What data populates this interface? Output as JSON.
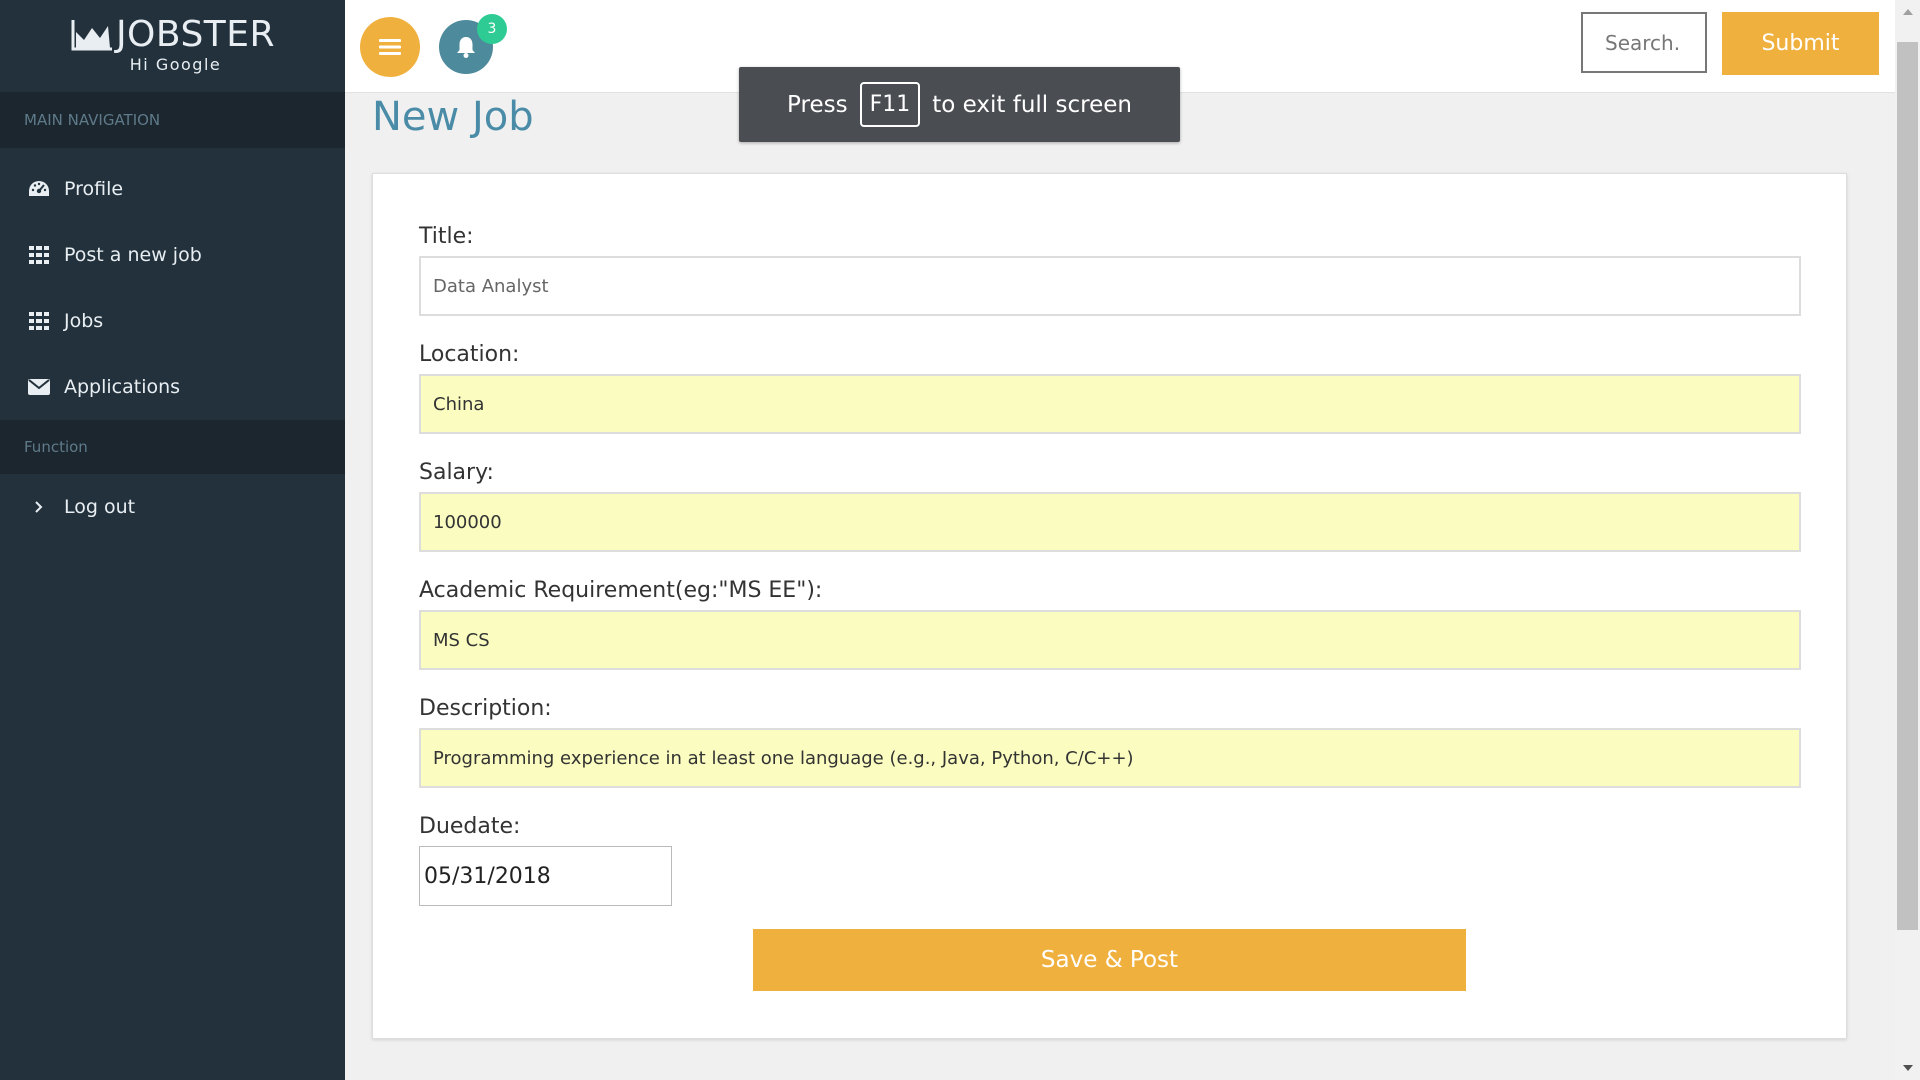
{
  "sidebar": {
    "brand_name": "JOBSTER",
    "greeting": "Hi Google",
    "nav_header": "MAIN NAVIGATION",
    "items": [
      {
        "label": "Profile",
        "icon": "dashboard-icon"
      },
      {
        "label": "Post a new job",
        "icon": "grid-icon"
      },
      {
        "label": "Jobs",
        "icon": "grid-icon"
      },
      {
        "label": "Applications",
        "icon": "envelope-icon"
      }
    ],
    "function_header": "Function",
    "logout_label": "Log out"
  },
  "topbar": {
    "notification_count": "3",
    "search_placeholder": "Search.",
    "submit_label": "Submit"
  },
  "fullscreen_toast": {
    "press": "Press",
    "key": "F11",
    "rest": "to exit full screen"
  },
  "page": {
    "title": "New Job"
  },
  "form": {
    "title_label": "Title:",
    "title_value": "Data Analyst",
    "location_label": "Location:",
    "location_value": "China",
    "salary_label": "Salary:",
    "salary_value": "100000",
    "academic_label": "Academic Requirement(eg:\"MS EE\"):",
    "academic_value": "MS CS",
    "description_label": "Description:",
    "description_value": "Programming experience in at least one language (e.g., Java, Python, C/C++)",
    "duedate_label": "Duedate:",
    "duedate_value": "05/31/2018",
    "save_label": "Save & Post"
  },
  "colors": {
    "sidebar_bg": "#22313c",
    "accent": "#f0b03d",
    "title_color": "#4a8ca8",
    "autofill_bg": "#fafcc0",
    "badge": "#2ecc94"
  }
}
